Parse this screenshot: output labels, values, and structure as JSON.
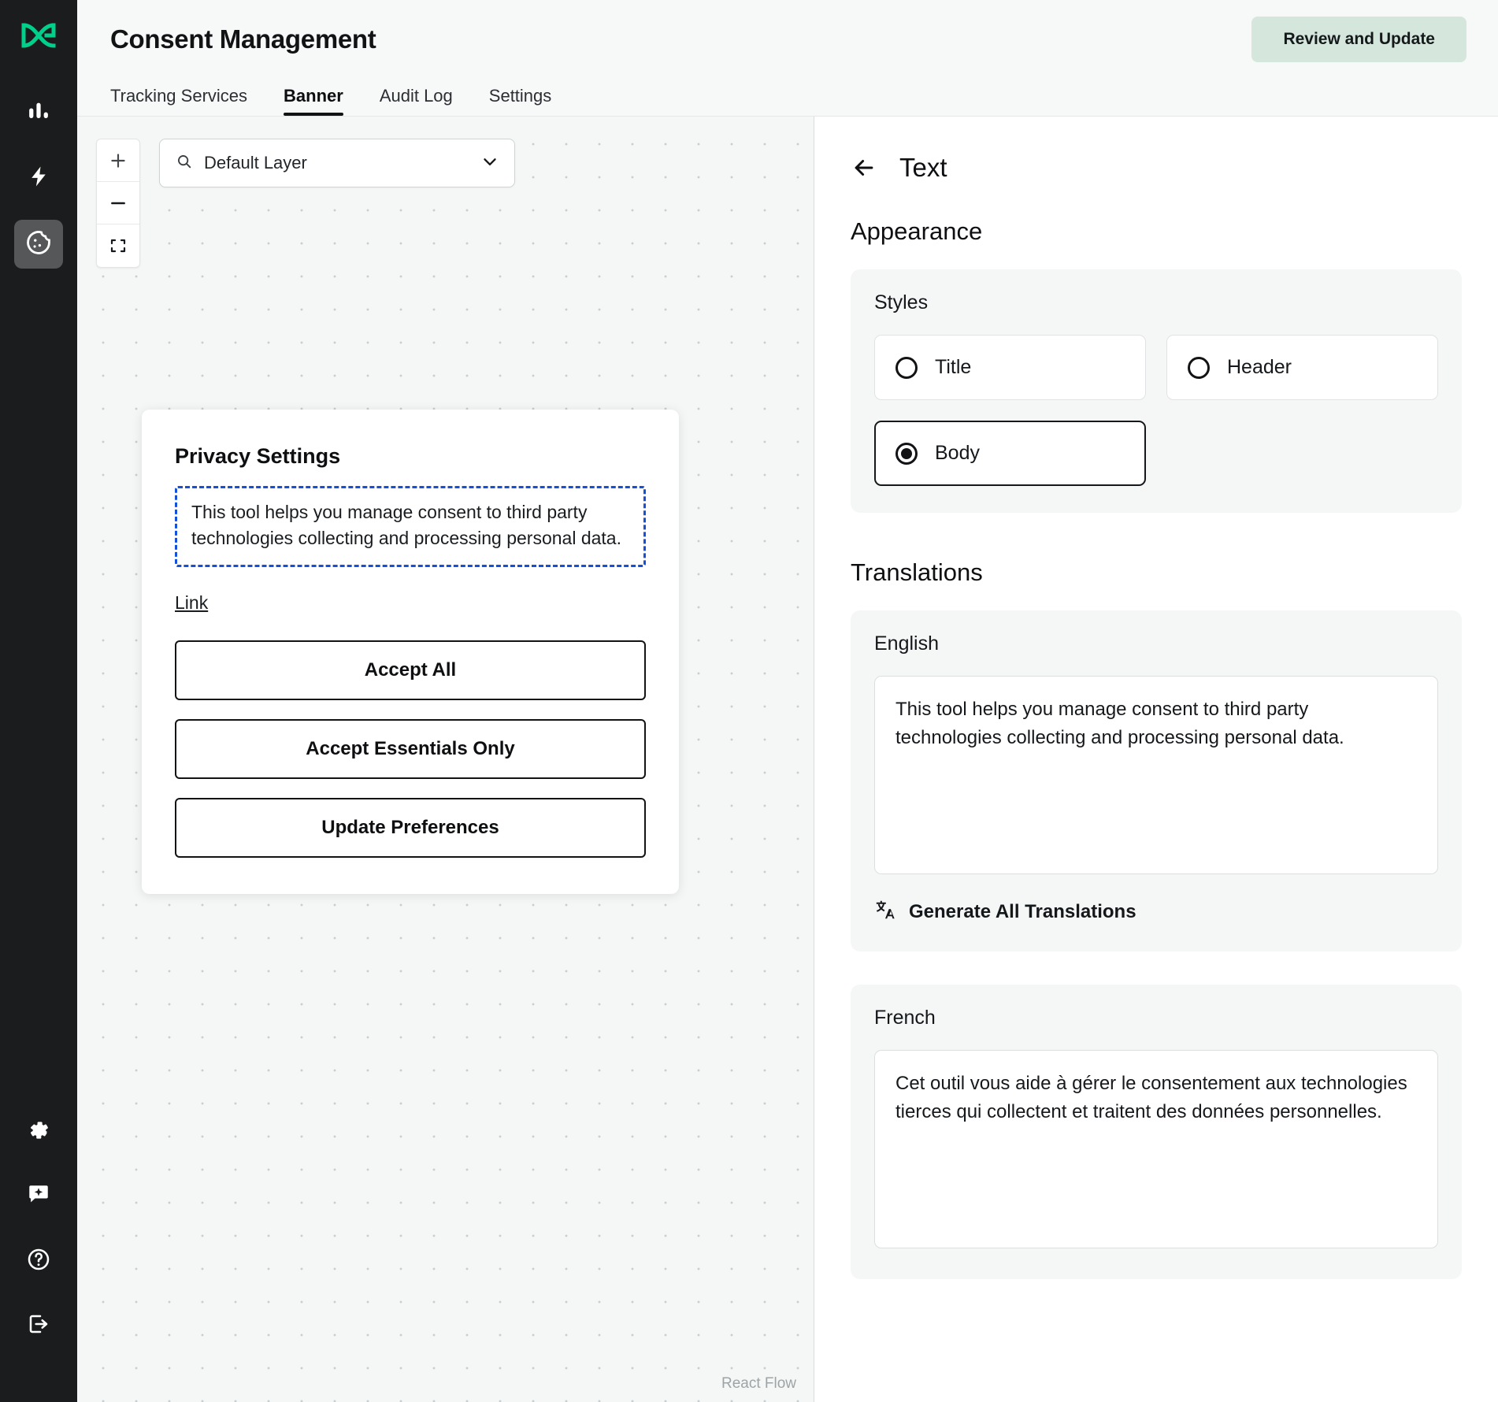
{
  "colors": {
    "rail_bg": "#1b1c1d",
    "logo_green": "#00d08a",
    "accent_button": "#d5e7dd",
    "selection_blue": "#1550d8",
    "canvas_bg": "#f5f7f7",
    "card_bg": "#f5f7f7"
  },
  "rail": {
    "logo_name": "brand-logo",
    "items": [
      {
        "icon": "analytics-bar-chart-icon",
        "label": "Analytics",
        "active": false
      },
      {
        "icon": "lightning-bolt-icon",
        "label": "Activation",
        "active": false
      },
      {
        "icon": "cookie-icon",
        "label": "Consent",
        "active": true
      }
    ],
    "bottom_items": [
      {
        "icon": "gear-icon",
        "label": "Settings"
      },
      {
        "icon": "ai-chat-sparkle-icon",
        "label": "Assistant"
      },
      {
        "icon": "help-circle-icon",
        "label": "Help"
      },
      {
        "icon": "logout-icon",
        "label": "Log out"
      }
    ]
  },
  "header": {
    "title": "Consent Management",
    "review_button": "Review and Update"
  },
  "tabs": [
    {
      "label": "Tracking Services",
      "active": false
    },
    {
      "label": "Banner",
      "active": true
    },
    {
      "label": "Audit Log",
      "active": false
    },
    {
      "label": "Settings",
      "active": false
    }
  ],
  "canvas": {
    "zoom_controls": [
      {
        "name": "zoom-in-button",
        "glyph": "+"
      },
      {
        "name": "zoom-out-button",
        "glyph": "−"
      },
      {
        "name": "fit-view-button",
        "glyph": "fit"
      }
    ],
    "layer_select": {
      "value": "Default Layer",
      "placeholder": "Default Layer",
      "icon": "search-icon",
      "chevron": "chevron-down-icon"
    },
    "attribution": "React Flow"
  },
  "banner_preview": {
    "title": "Privacy Settings",
    "body": "This tool helps you manage consent to third party technologies collecting and processing personal data.",
    "link": "Link",
    "buttons": [
      "Accept All",
      "Accept Essentials Only",
      "Update Preferences"
    ]
  },
  "panel": {
    "back_icon": "arrow-left-icon",
    "title": "Text",
    "appearance": {
      "section_title": "Appearance",
      "styles_label": "Styles",
      "options": [
        {
          "label": "Title",
          "selected": false
        },
        {
          "label": "Header",
          "selected": false
        },
        {
          "label": "Body",
          "selected": true
        }
      ]
    },
    "translations": {
      "section_title": "Translations",
      "generate_label": "Generate All Translations",
      "generate_icon": "translate-icon",
      "entries": [
        {
          "language": "English",
          "value": "This tool helps you manage consent to third party technologies collecting and processing personal data."
        },
        {
          "language": "French",
          "value": "Cet outil vous aide à gérer le consentement aux technologies tierces qui collectent et traitent des données personnelles."
        }
      ]
    }
  }
}
